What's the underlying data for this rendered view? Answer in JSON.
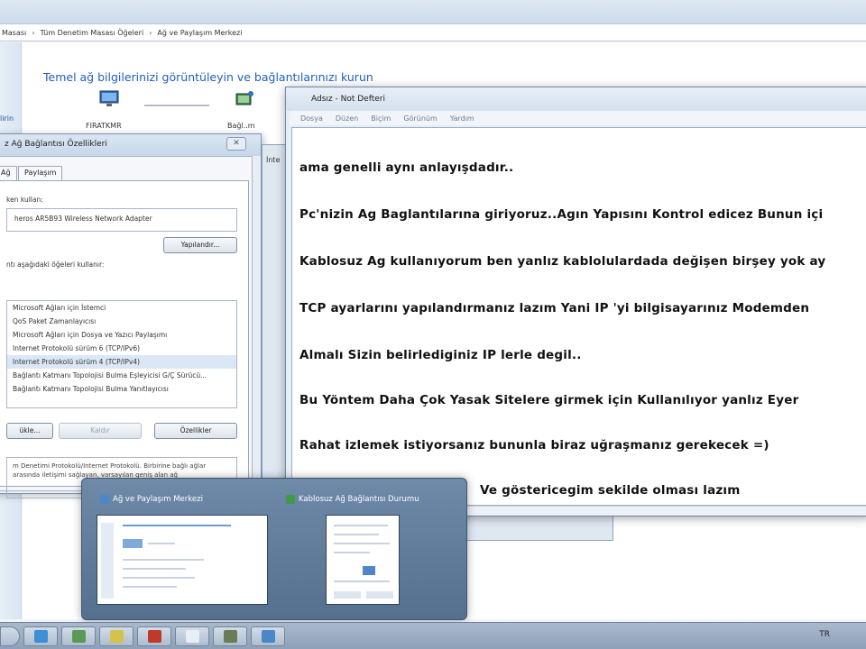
{
  "address_bar": {
    "crumb_1": "Masası",
    "crumb_2": "Tüm Denetim Masası Öğeleri",
    "crumb_3": "Ağ ve Paylaşım Merkezi"
  },
  "control_panel": {
    "heading": "Temel ağ bilgilerinizi görüntüleyin ve bağlantılarınızı kurun",
    "sidebar_text": "lirin",
    "computer_label": "FIRATKMR",
    "network_label": "Bağl..m"
  },
  "properties_dialog": {
    "title": "z Ağ Bağlantısı Özellikleri",
    "close": "✕",
    "tab_network": "Ağ",
    "tab_sharing": "Paylaşım",
    "connect_using_label": "ken kullan:",
    "adapter": "heros AR5B93 Wireless Network Adapter",
    "configure_button": "Yapılandır...",
    "items_label": "ntı aşağıdaki öğeleri kullanır:",
    "items": [
      "Microsoft Ağları için İstemci",
      "QoS Paket Zamanlayıcısı",
      "Microsoft Ağları için Dosya ve Yazıcı Paylaşımı",
      "Internet Protokolü sürüm 6 (TCP/IPv6)",
      "Internet Protokolü sürüm 4 (TCP/IPv4)",
      "Bağlantı Katmanı Topolojisi Bulma Eşleyicisi G/Ç Sürücü...",
      "Bağlantı Katmanı Topolojisi Bulma Yanıtlayıcısı"
    ],
    "install_button": "ükle...",
    "uninstall_button": "Kaldır",
    "properties_button": "Özellikler",
    "description": "m Denetimi Protokolü/Internet Protokolü. Birbirine bağlı ağlar arasında iletişimi sağlayan, varsayılan geniş alan ağ"
  },
  "back_window": {
    "tab_label": "İnte"
  },
  "notepad": {
    "title": "Adsız - Not Defteri",
    "menu": [
      "Dosya",
      "Düzen",
      "Biçim",
      "Görünüm",
      "Yardım"
    ],
    "lines": [
      "ama genelli aynı anlayışdadır..",
      "Pc'nizin Ag Baglantılarına giriyoruz..Agın Yapısını Kontrol edicez Bunun içi",
      "Kablosuz Ag kullanıyorum ben yanlız kablolulardada değişen birşey yok ay",
      "TCP ayarlarını yapılandırmanız lazım Yani IP 'yi bilgisayarınız Modemden",
      "Almalı Sizin belirlediginiz IP lerle degil..",
      "Bu Yöntem Daha Çok Yasak Sitelere girmek için Kullanılıyor yanlız Eyer",
      "Rahat izlemek istiyorsanız bununla biraz uğraşmanız gerekecek =)",
      "Ve göstericegim sekilde olması lazım"
    ]
  },
  "thumbnails": [
    {
      "title": "Ağ ve Paylaşım Merkezi"
    },
    {
      "title": "Kablosuz Ağ Bağlantısı Durumu"
    }
  ],
  "taskbar": {
    "language": "TR",
    "buttons": [
      "start",
      "ie-icon",
      "explorer-icon",
      "network-icon",
      "media-icon",
      "notepad-icon",
      "paint-icon",
      "chat-icon"
    ]
  },
  "colors": {
    "heading_blue": "#1f5fbf",
    "taskbar": "#9fb0c5",
    "thumb_popup": "#6682a3"
  }
}
